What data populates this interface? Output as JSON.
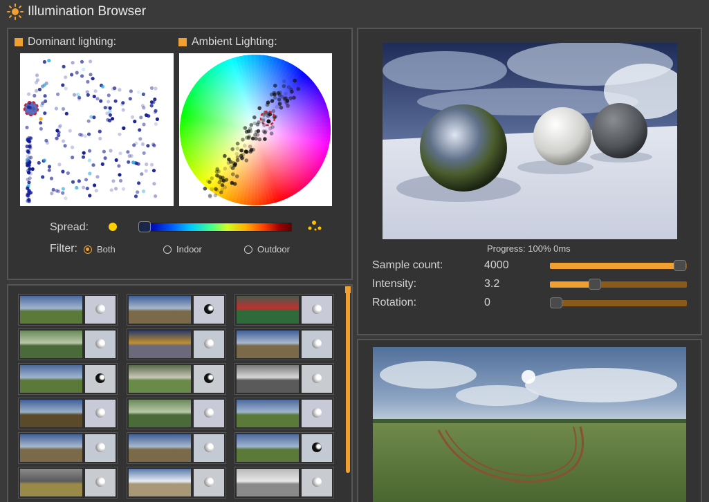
{
  "app": {
    "title": "Illumination Browser"
  },
  "analysis": {
    "dominant_label": "Dominant lighting:",
    "ambient_label": "Ambient Lighting:",
    "spread_label": "Spread:",
    "filter_label": "Filter:",
    "filter_options": [
      {
        "label": "Both",
        "selected": true
      },
      {
        "label": "Indoor",
        "selected": false
      },
      {
        "label": "Outdoor",
        "selected": false
      }
    ],
    "spread_value": 0.0
  },
  "render": {
    "progress_label": "Progress:",
    "progress_value": "100% 0ms",
    "sliders": [
      {
        "label": "Sample count:",
        "value": "4000",
        "level": 0.95
      },
      {
        "label": "Intensity:",
        "value": "3.2",
        "level": 0.33
      },
      {
        "label": "Rotation:",
        "value": "0",
        "level": 0.0
      }
    ]
  },
  "colors": {
    "accent": "#f0a030",
    "track": "#8a5a1a",
    "panel_bg": "#333333",
    "page_bg": "#3a3a3a"
  },
  "thumbnails": {
    "columns": 3,
    "rows": 6,
    "env_styles": [
      "sky-grass",
      "sky-dirt",
      "indoor-green",
      "foliage",
      "indoor-blue",
      "sky-dirt",
      "sky-grass",
      "foliage-sphere",
      "indoor-hall",
      "sky-trees",
      "foliage",
      "sky-grass",
      "sky-dirt",
      "sky-dirt",
      "sky-grass",
      "people",
      "sky-sand",
      "indoor-white"
    ]
  }
}
